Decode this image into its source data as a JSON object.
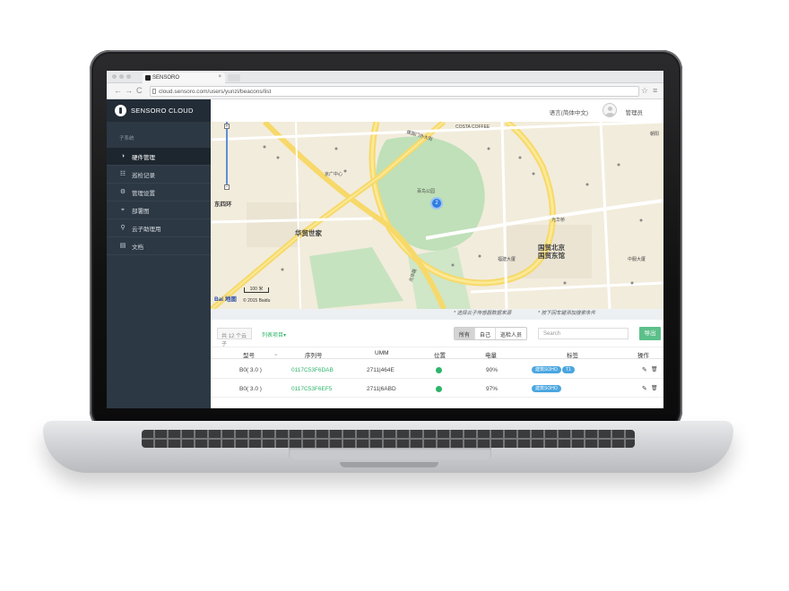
{
  "browser": {
    "tab_title": "SENSORO",
    "tab_close": "×",
    "back": "←",
    "forward": "→",
    "reload": "C",
    "url": "cloud.sensoro.com/users/yunzi/beacons/list",
    "star": "☆",
    "menu": "≡"
  },
  "brand": {
    "name": "SENSORO CLOUD"
  },
  "sidebar": {
    "section": "子系统",
    "items": [
      {
        "label": "硬件管理",
        "icon": "◑",
        "icon_name": "hardware-icon",
        "active": true
      },
      {
        "label": "巡检记录",
        "icon": "☷",
        "icon_name": "list-icon"
      },
      {
        "label": "管理设置",
        "icon": "⚙",
        "icon_name": "gear-icon"
      },
      {
        "label": "部署图",
        "icon": "⌖",
        "icon_name": "location-icon"
      },
      {
        "label": "云子助理用",
        "icon": "⚲",
        "icon_name": "key-icon"
      },
      {
        "label": "文档",
        "icon": "▤",
        "icon_name": "document-icon"
      }
    ]
  },
  "header": {
    "language": "语言(简体中文)",
    "user": "管理员"
  },
  "map": {
    "labels": [
      {
        "text": "华贸世家",
        "big": true
      },
      {
        "text": "国贸北京\n国贸东馆",
        "big": true
      },
      {
        "text": "东四环"
      },
      {
        "text": "百鸟公园"
      },
      {
        "text": "COSTA COFFEE"
      },
      {
        "text": "光华路"
      },
      {
        "text": "建国门外大街"
      },
      {
        "text": "京广中心"
      },
      {
        "text": "中服大厦"
      },
      {
        "text": "福建大厦"
      },
      {
        "text": "光华桥"
      },
      {
        "text": "朝阳"
      }
    ],
    "cluster_count": "2",
    "zoom_in": "+",
    "zoom_out": "−",
    "baidu": "Bai 地图",
    "scale": "100 米",
    "copyright": "© 2015 Baidu"
  },
  "toolbar": {
    "count_label": "共 12 个云子",
    "list_link": "列表项目▾",
    "source_hint": "* 选择云子传感器数据来源",
    "search_hint": "* 按下回车键添加搜索条件",
    "filters": [
      "所有",
      "自己",
      "巡检人员"
    ],
    "search_placeholder": "Search",
    "export": "导出"
  },
  "table": {
    "columns": [
      "型号",
      "序列号",
      "UMM",
      "位置",
      "电量",
      "标签",
      "操作"
    ],
    "sort_icon": "⌄",
    "rows": [
      {
        "model": "B0( 3.0 )",
        "serial": "0117C53F6DAB",
        "umm": "2711|464E",
        "battery": "90%",
        "tags": [
          "建筑SOHO",
          "T1"
        ],
        "edit": "✎",
        "delete": "🗑"
      },
      {
        "model": "B0( 3.0 )",
        "serial": "0117C53F6EF5",
        "umm": "2711|6ABD",
        "battery": "97%",
        "tags": [
          "建筑SOHO"
        ],
        "edit": "✎",
        "delete": "🗑"
      }
    ]
  },
  "colors": {
    "sidebar_bg": "#2c3844",
    "accent_green": "#2db56a",
    "export_green": "#5cc08a",
    "tag_blue": "#4aa6e0",
    "cluster_blue": "#2f7de0"
  }
}
